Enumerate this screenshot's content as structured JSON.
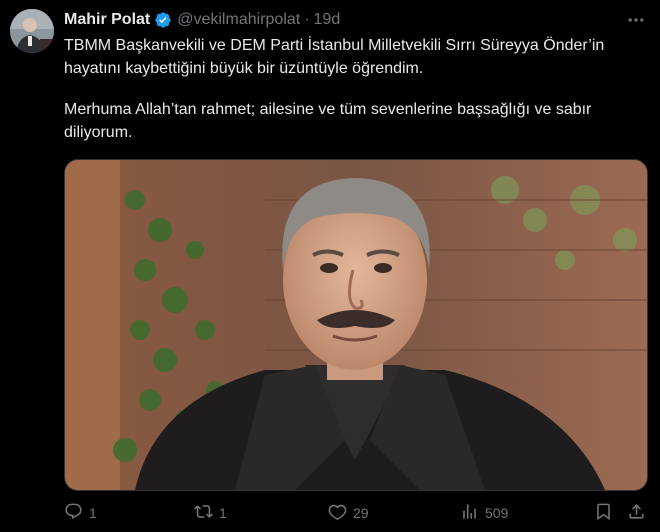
{
  "author": {
    "name": "Mahir Polat",
    "handle": "@vekilmahirpolat",
    "separator": "·",
    "time": "19d",
    "verified": true
  },
  "tweet": {
    "paragraphs": [
      "TBMM Başkanvekili ve DEM Parti İstanbul Milletvekili Sırrı Süreyya Önder’in hayatını kaybettiğini büyük bir üzüntüyle öğrendim.",
      "Merhuma Allah’tan rahmet; ailesine ve tüm sevenlerine başsağlığı ve sabır diliyorum."
    ]
  },
  "metrics": {
    "replies": "1",
    "reposts": "1",
    "likes": "29",
    "views": "509"
  },
  "colors": {
    "background": "#000000",
    "text": "#e7e9ea",
    "muted": "#71767b",
    "verified": "#1d9bf0",
    "border": "#2f3336"
  },
  "icons": {
    "verified": "verified-badge-icon",
    "more": "more-dots-icon",
    "reply": "reply-icon",
    "repost": "repost-icon",
    "like": "heart-icon",
    "views": "views-icon",
    "bookmark": "bookmark-icon",
    "share": "share-icon"
  }
}
